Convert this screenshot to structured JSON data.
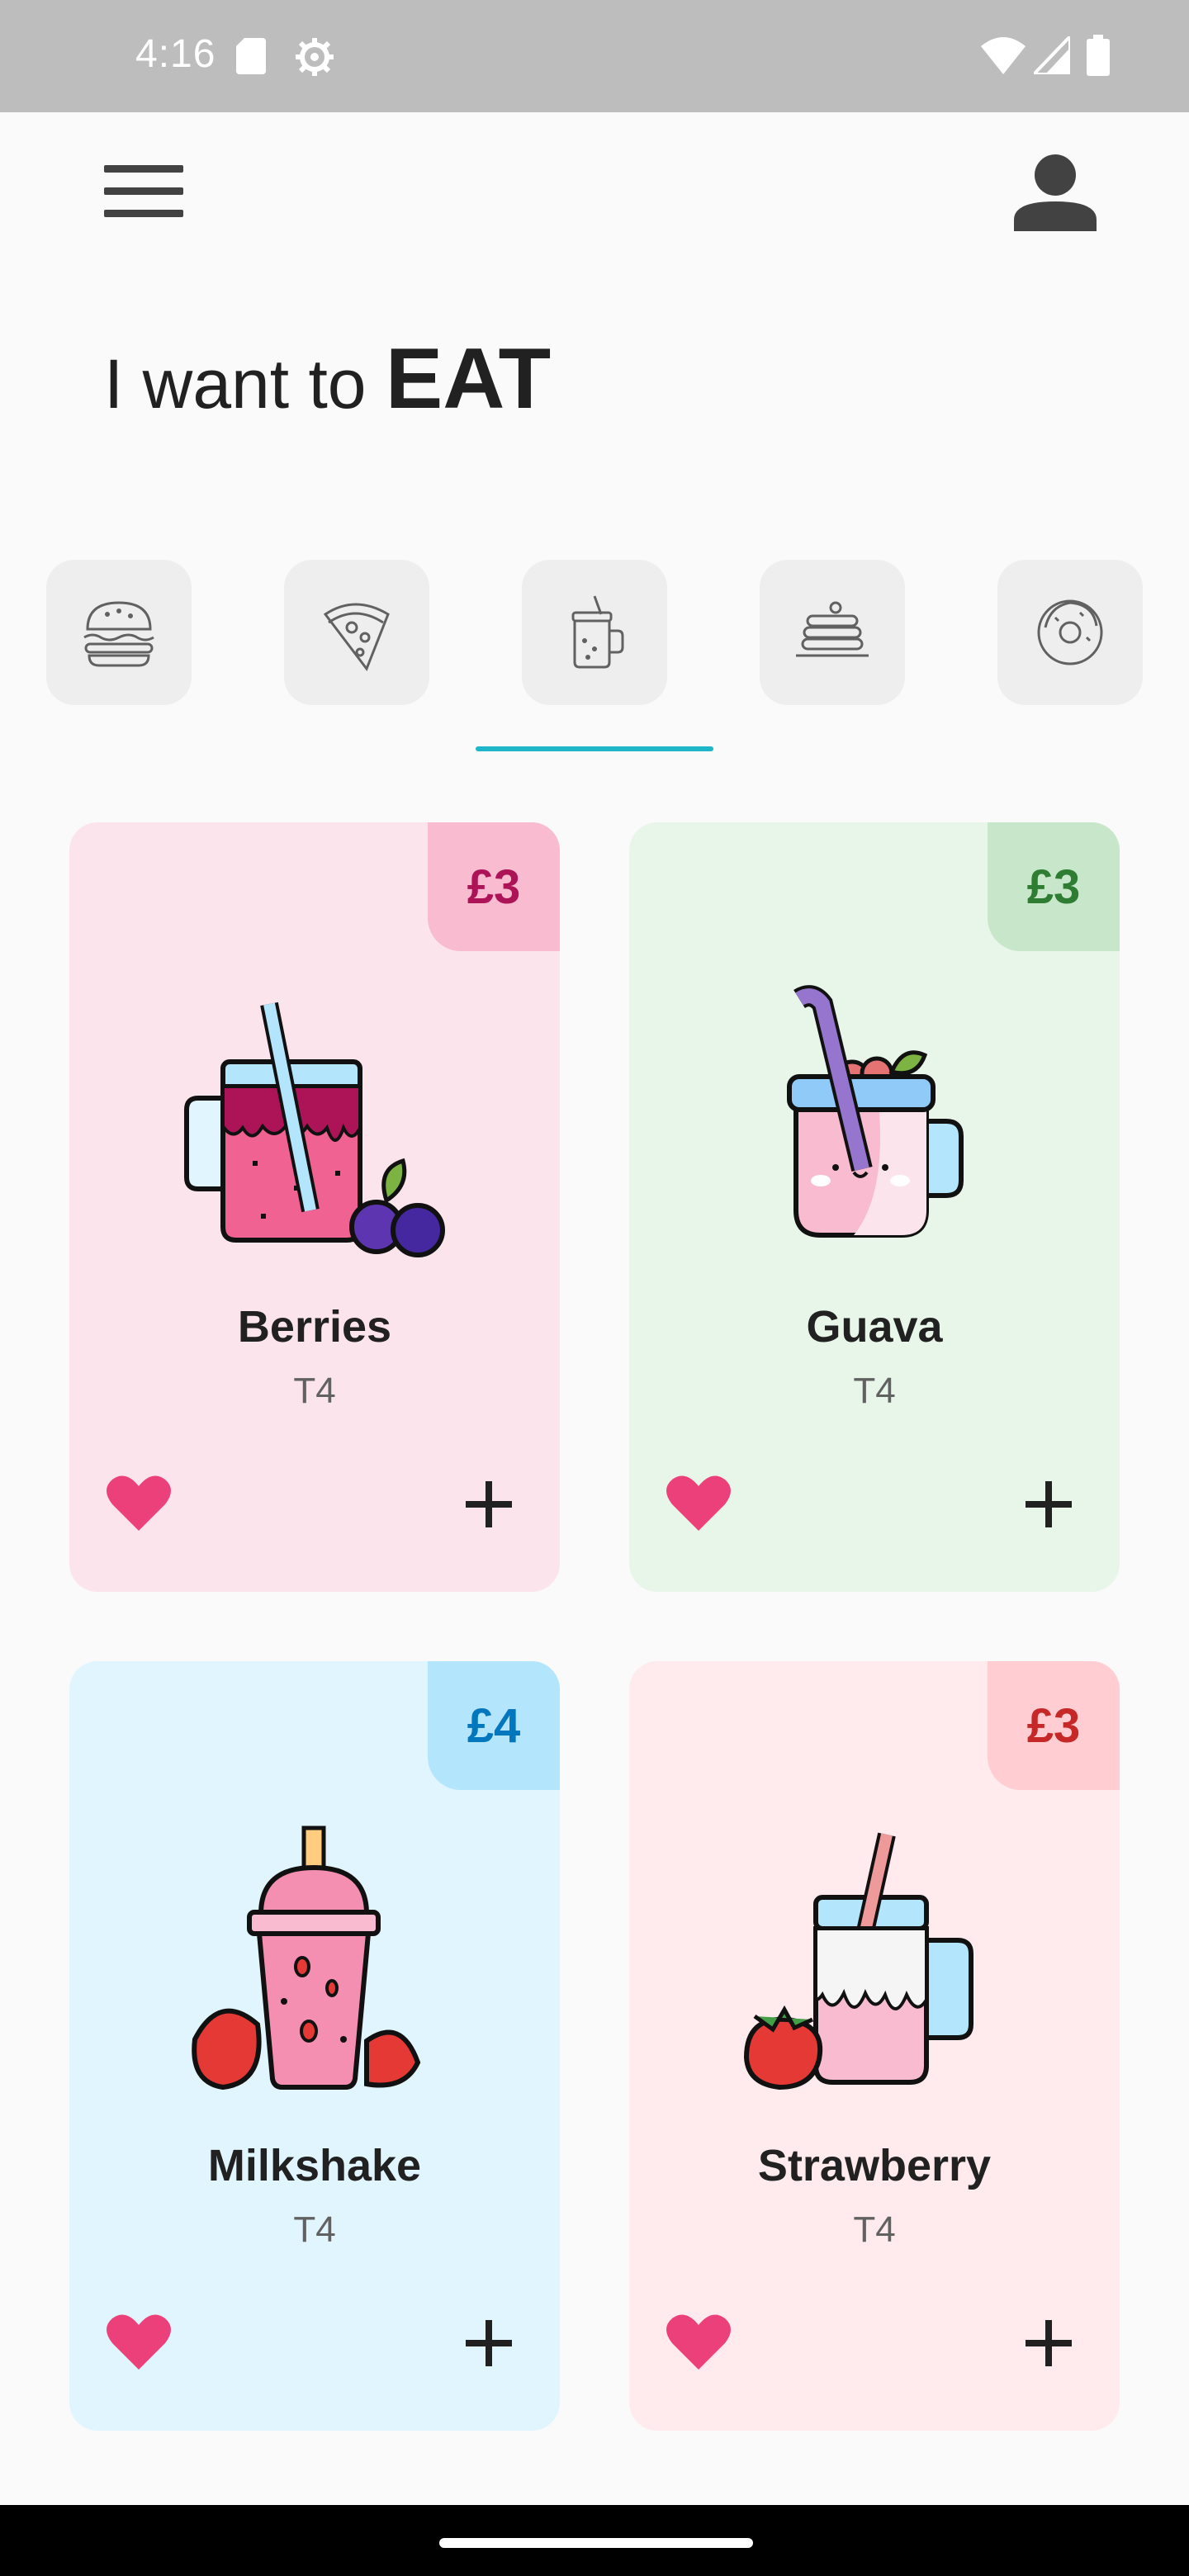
{
  "status_bar": {
    "time": "4:16"
  },
  "header": {
    "title_prefix": "I want to",
    "title_emphasis": "EAT"
  },
  "categories": [
    {
      "icon": "burger-icon"
    },
    {
      "icon": "pizza-icon"
    },
    {
      "icon": "drink-jar-icon",
      "selected": true
    },
    {
      "icon": "pancakes-icon"
    },
    {
      "icon": "donut-icon"
    }
  ],
  "products": [
    {
      "name": "Berries",
      "subtitle": "T4",
      "price": "£3",
      "bg": "#fce4ec",
      "badge_bg": "#f8bbd0",
      "badge_color": "#ad1457"
    },
    {
      "name": "Guava",
      "subtitle": "T4",
      "price": "£3",
      "bg": "#e8f5e9",
      "badge_bg": "#c8e6c9",
      "badge_color": "#2e7d32"
    },
    {
      "name": "Milkshake",
      "subtitle": "T4",
      "price": "£4",
      "bg": "#e1f5fe",
      "badge_bg": "#b3e5fc",
      "badge_color": "#0277bd"
    },
    {
      "name": "Strawberry",
      "subtitle": "T4",
      "price": "£3",
      "bg": "#ffebee",
      "badge_bg": "#ffcdd2",
      "badge_color": "#c62828"
    }
  ],
  "colors": {
    "accent": "#1fb6c9",
    "heart": "#ec407a"
  }
}
